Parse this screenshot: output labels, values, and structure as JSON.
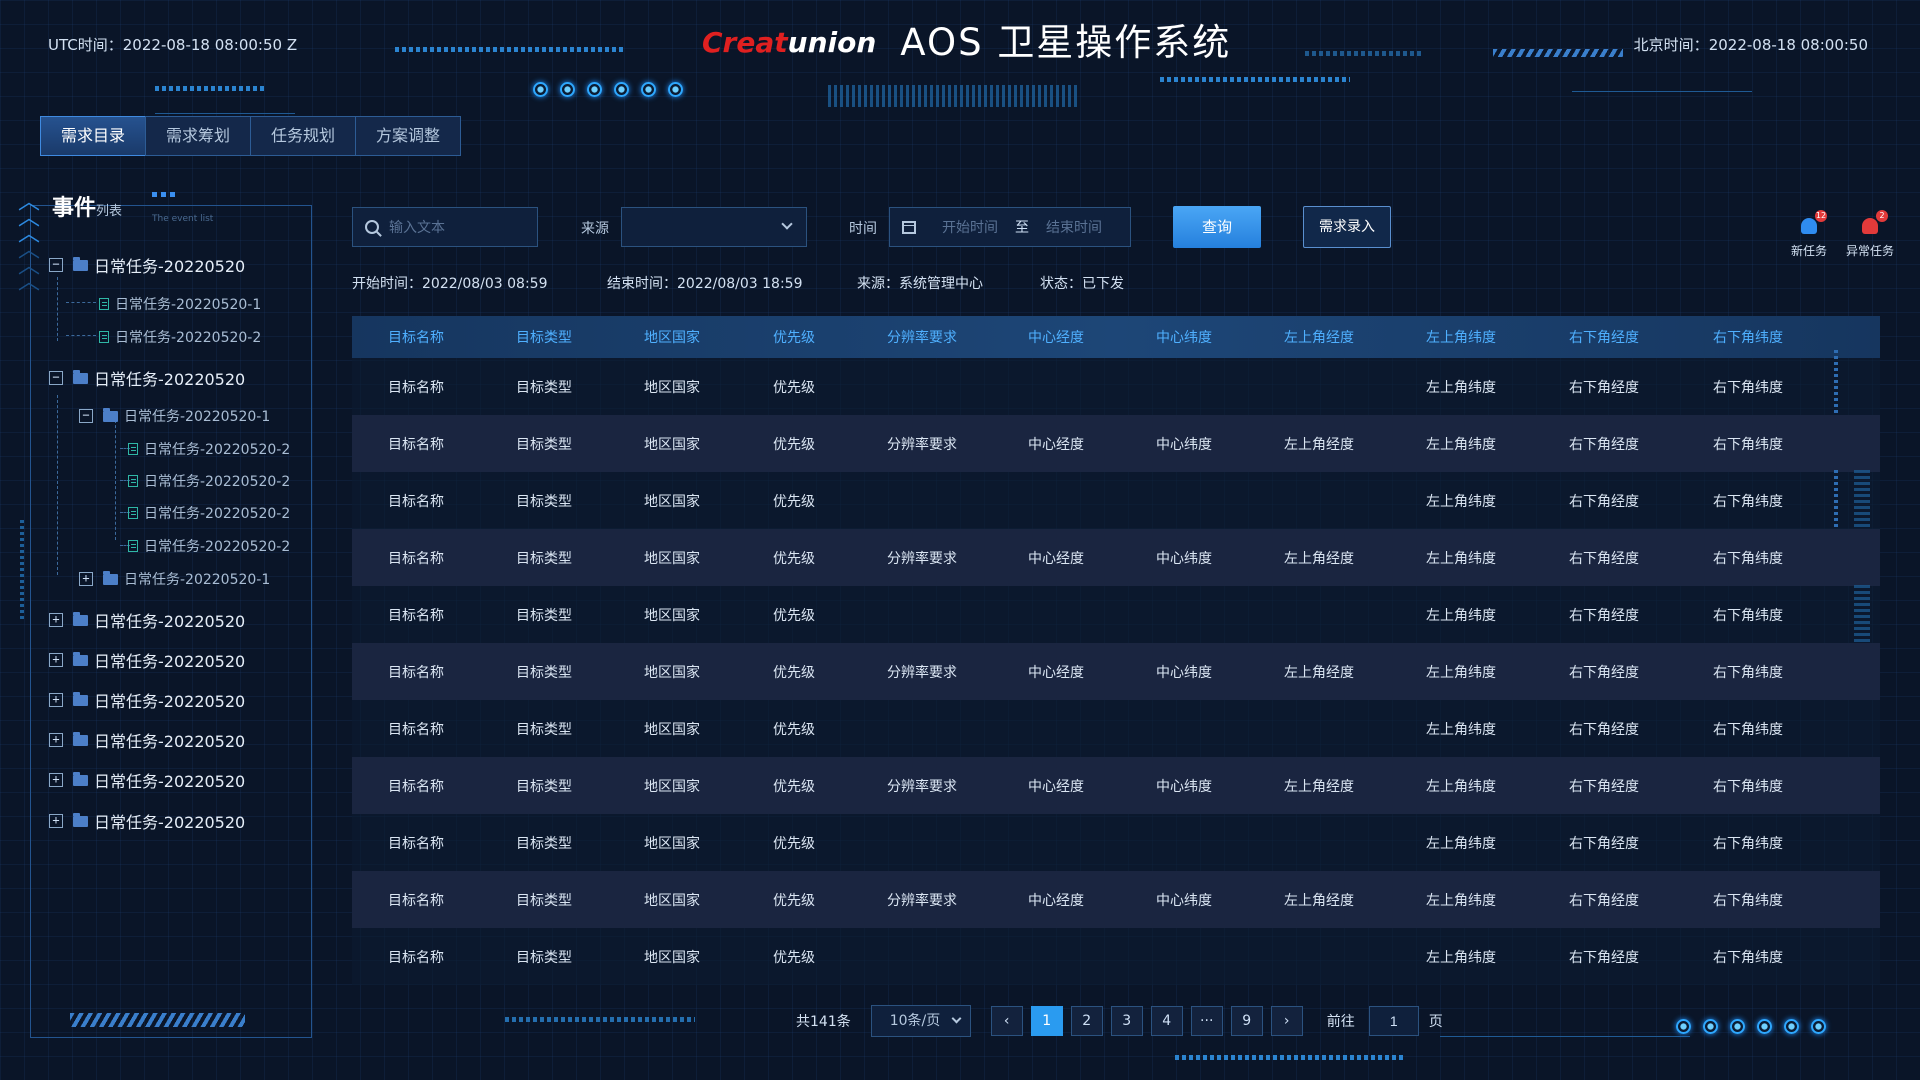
{
  "header": {
    "utc_label": "UTC时间",
    "utc_value": "2022-08-18 08:00:50 Z",
    "bj_label": "北京时间",
    "bj_value": "2022-08-18 08:00:50",
    "logo_part1": "Creat",
    "logo_part2": "union",
    "title": "AOS 卫星操作系统"
  },
  "tabs": [
    "需求目录",
    "需求筹划",
    "任务规划",
    "方案调整"
  ],
  "sidebar": {
    "title": "事件",
    "title_small": "列表",
    "subtitle": "The event list",
    "tree": [
      {
        "label": "日常任务-20220520",
        "toggle": "−"
      },
      {
        "label": "日常任务-20220520-1"
      },
      {
        "label": "日常任务-20220520-2"
      },
      {
        "label": "日常任务-20220520",
        "toggle": "−"
      },
      {
        "label": "日常任务-20220520-1",
        "toggle": "−"
      },
      {
        "label": "日常任务-20220520-2"
      },
      {
        "label": "日常任务-20220520-2"
      },
      {
        "label": "日常任务-20220520-2"
      },
      {
        "label": "日常任务-20220520-2"
      },
      {
        "label": "日常任务-20220520-1",
        "toggle": "+"
      },
      {
        "label": "日常任务-20220520",
        "toggle": "+"
      },
      {
        "label": "日常任务-20220520",
        "toggle": "+"
      },
      {
        "label": "日常任务-20220520",
        "toggle": "+"
      },
      {
        "label": "日常任务-20220520",
        "toggle": "+"
      },
      {
        "label": "日常任务-20220520",
        "toggle": "+"
      },
      {
        "label": "日常任务-20220520",
        "toggle": "+"
      }
    ]
  },
  "filters": {
    "search_placeholder": "输入文本",
    "source_label": "来源",
    "source_value": "",
    "time_label": "时间",
    "start_placeholder": "开始时间",
    "range_sep": "至",
    "end_placeholder": "结束时间",
    "query_button": "查询",
    "entry_button": "需求录入"
  },
  "notifications": [
    {
      "label": "新任务",
      "count": "12",
      "color": "#2f8cf0"
    },
    {
      "label": "异常任务",
      "count": "2",
      "color": "#e23a3a"
    }
  ],
  "info": {
    "start": "开始时间：2022/08/03  08:59",
    "end": "结束时间：2022/08/03  18:59",
    "source": "来源：系统管理中心",
    "status": "状态：已下发"
  },
  "table": {
    "columns": [
      "目标名称",
      "目标类型",
      "地区国家",
      "优先级",
      "分辨率要求",
      "中心经度",
      "中心纬度",
      "左上角经度",
      "左上角纬度",
      "右下角经度",
      "右下角纬度"
    ],
    "rows": [
      [
        "目标名称",
        "目标类型",
        "地区国家",
        "优先级",
        "",
        "",
        "",
        "",
        "左上角纬度",
        "右下角经度",
        "右下角纬度"
      ],
      [
        "目标名称",
        "目标类型",
        "地区国家",
        "优先级",
        "分辨率要求",
        "中心经度",
        "中心纬度",
        "左上角经度",
        "左上角纬度",
        "右下角经度",
        "右下角纬度"
      ],
      [
        "目标名称",
        "目标类型",
        "地区国家",
        "优先级",
        "",
        "",
        "",
        "",
        "左上角纬度",
        "右下角经度",
        "右下角纬度"
      ],
      [
        "目标名称",
        "目标类型",
        "地区国家",
        "优先级",
        "分辨率要求",
        "中心经度",
        "中心纬度",
        "左上角经度",
        "左上角纬度",
        "右下角经度",
        "右下角纬度"
      ],
      [
        "目标名称",
        "目标类型",
        "地区国家",
        "优先级",
        "",
        "",
        "",
        "",
        "左上角纬度",
        "右下角经度",
        "右下角纬度"
      ],
      [
        "目标名称",
        "目标类型",
        "地区国家",
        "优先级",
        "分辨率要求",
        "中心经度",
        "中心纬度",
        "左上角经度",
        "左上角纬度",
        "右下角经度",
        "右下角纬度"
      ],
      [
        "目标名称",
        "目标类型",
        "地区国家",
        "优先级",
        "",
        "",
        "",
        "",
        "左上角纬度",
        "右下角经度",
        "右下角纬度"
      ],
      [
        "目标名称",
        "目标类型",
        "地区国家",
        "优先级",
        "分辨率要求",
        "中心经度",
        "中心纬度",
        "左上角经度",
        "左上角纬度",
        "右下角经度",
        "右下角纬度"
      ],
      [
        "目标名称",
        "目标类型",
        "地区国家",
        "优先级",
        "",
        "",
        "",
        "",
        "左上角纬度",
        "右下角经度",
        "右下角纬度"
      ],
      [
        "目标名称",
        "目标类型",
        "地区国家",
        "优先级",
        "分辨率要求",
        "中心经度",
        "中心纬度",
        "左上角经度",
        "左上角纬度",
        "右下角经度",
        "右下角纬度"
      ],
      [
        "目标名称",
        "目标类型",
        "地区国家",
        "优先级",
        "",
        "",
        "",
        "",
        "左上角纬度",
        "右下角经度",
        "右下角纬度"
      ]
    ]
  },
  "pagination": {
    "total": "共141条",
    "page_size": "10条/页",
    "pages": [
      "1",
      "2",
      "3",
      "4",
      "···",
      "9"
    ],
    "current": "1",
    "goto_label": "前往",
    "goto_value": "1",
    "page_unit": "页"
  }
}
